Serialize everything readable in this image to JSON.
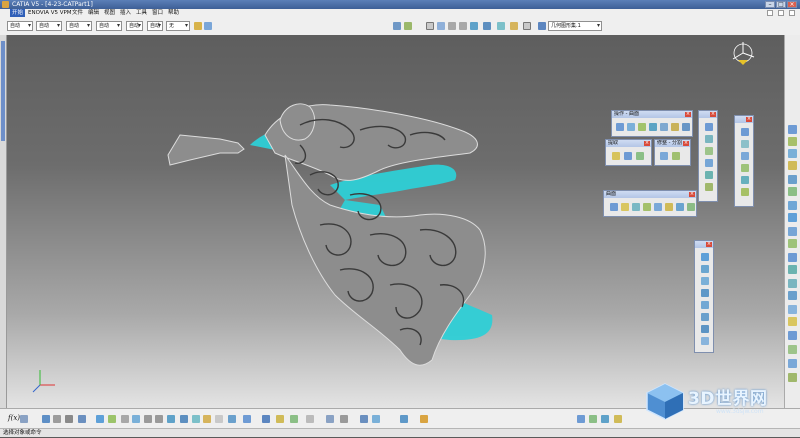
{
  "window": {
    "title": "CATIA V5 - [4-23-CATPart1]"
  },
  "menu": [
    "开始",
    "ENOVIA V5 VPM",
    "文件",
    "编辑",
    "视图",
    "插入",
    "工具",
    "窗口",
    "帮助"
  ],
  "style_bar": {
    "combos": [
      "自动",
      "自动",
      "自动",
      "自动",
      "自动",
      "自动",
      "无"
    ],
    "geometry_set": "几何图形集.1"
  },
  "palettes": {
    "sweep": {
      "title": "操作 - 曲面"
    },
    "extract": {
      "title": "提取"
    },
    "transform": {
      "title": "修整 - 分割"
    },
    "surfaces": {
      "title": "曲面"
    }
  },
  "formula_label": "f(x)",
  "status": {
    "text": "选择对象或命令"
  },
  "watermark": {
    "brand": "3D世界网",
    "site": "www.3dsjw.com"
  },
  "colors": {
    "model_metal": "#8d8d8d",
    "model_back": "#2ecfd6",
    "accent": "#2f5fb8"
  },
  "icons": [
    "compass-icon",
    "search-icon",
    "gear-icon",
    "close-icon"
  ]
}
